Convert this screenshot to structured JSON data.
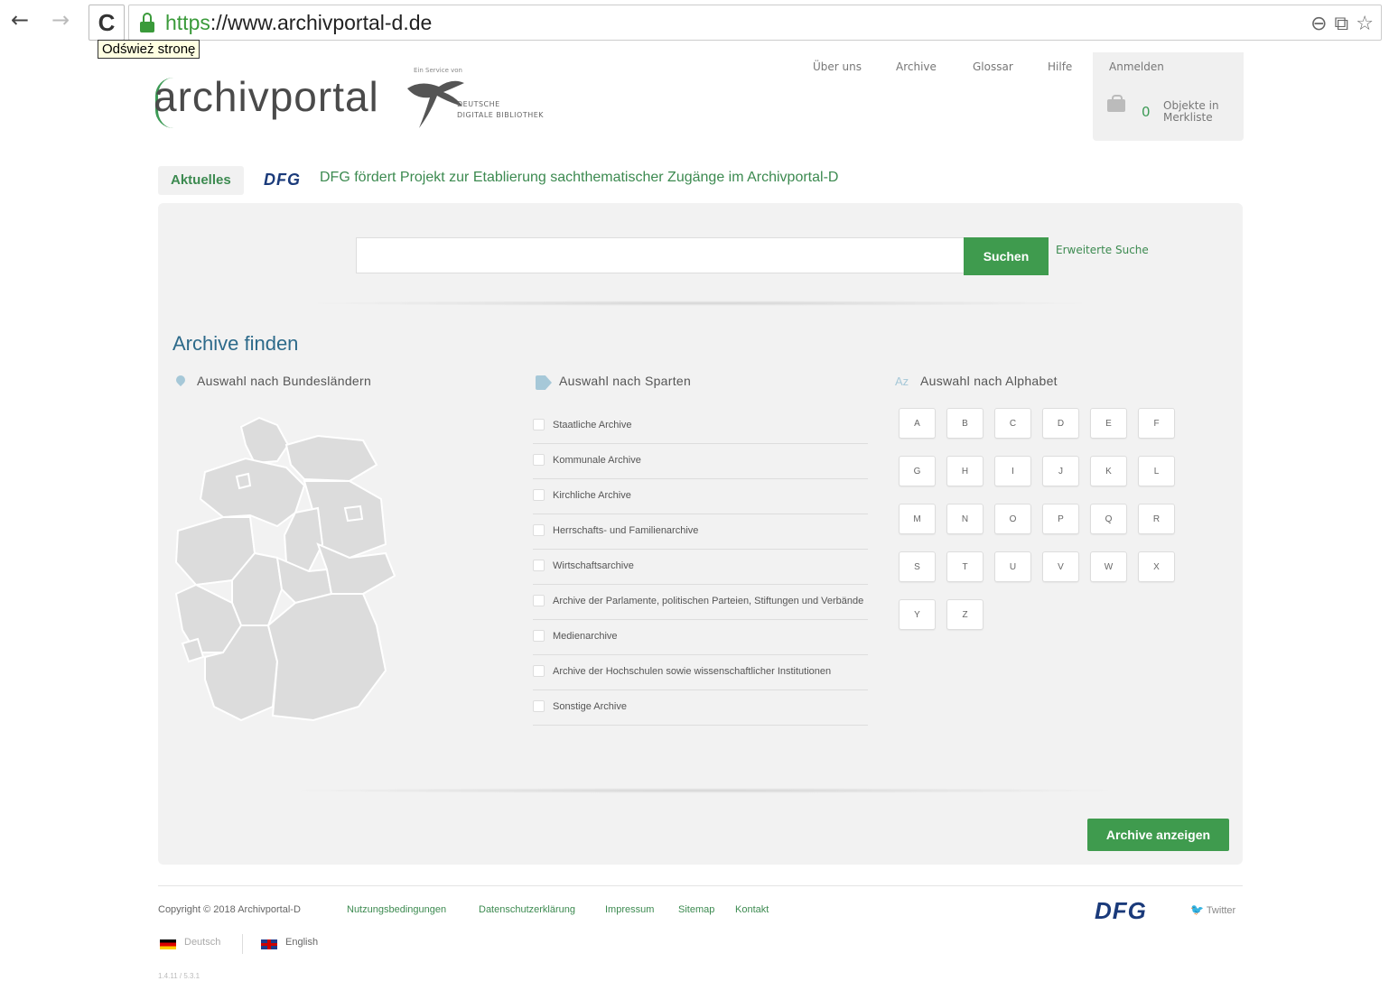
{
  "browser": {
    "url_scheme": "https",
    "url_rest": "://www.archivportal-d.de",
    "tooltip": "Odśwież stronę"
  },
  "header": {
    "logo": "archivportal",
    "ddb_service": "Ein Service von",
    "ddb_line1": "DEUTSCHE",
    "ddb_line2": "DIGITALE BIBLIOTHEK",
    "nav": [
      "Über uns",
      "Archive",
      "Glossar",
      "Hilfe"
    ],
    "login": "Anmelden",
    "merkliste_count": "0",
    "merkliste_label": "Objekte in Merkliste"
  },
  "news": {
    "tag": "Aktuelles",
    "dfg": "DFG",
    "text": "DFG fördert Projekt zur Etablierung sachthematischer Zugänge im Archivportal-D"
  },
  "search": {
    "value": "",
    "button": "Suchen",
    "advanced": "Erweiterte Suche"
  },
  "archive_finden": {
    "title": "Archive finden",
    "col_states": "Auswahl nach Bundesländern",
    "col_sparten": "Auswahl nach Sparten",
    "col_alpha": "Auswahl nach Alphabet",
    "az_icon_text": "Az",
    "sparten": [
      "Staatliche Archive",
      "Kommunale Archive",
      "Kirchliche Archive",
      "Herrschafts- und Familienarchive",
      "Wirtschaftsarchive",
      "Archive der Parlamente, politischen Parteien, Stiftungen und Verbände",
      "Medienarchive",
      "Archive der Hochschulen sowie wissenschaftlicher Institutionen",
      "Sonstige Archive"
    ],
    "letters": [
      "A",
      "B",
      "C",
      "D",
      "E",
      "F",
      "G",
      "H",
      "I",
      "J",
      "K",
      "L",
      "M",
      "N",
      "O",
      "P",
      "Q",
      "R",
      "S",
      "T",
      "U",
      "V",
      "W",
      "X",
      "Y",
      "Z"
    ],
    "show_button": "Archive anzeigen"
  },
  "footer": {
    "copyright": "Copyright © 2018 Archivportal-D",
    "links": [
      "Nutzungsbedingungen",
      "Datenschutzerklärung",
      "Impressum",
      "Sitemap",
      "Kontakt"
    ],
    "dfg": "DFG",
    "twitter": "Twitter",
    "lang_de": "Deutsch",
    "lang_en": "English",
    "version": "1.4.11 / 5.3.1"
  },
  "colors": {
    "accent_green": "#3f9b4e",
    "title_blue": "#2d6a8a",
    "dfg_blue": "#1a3a7a"
  }
}
